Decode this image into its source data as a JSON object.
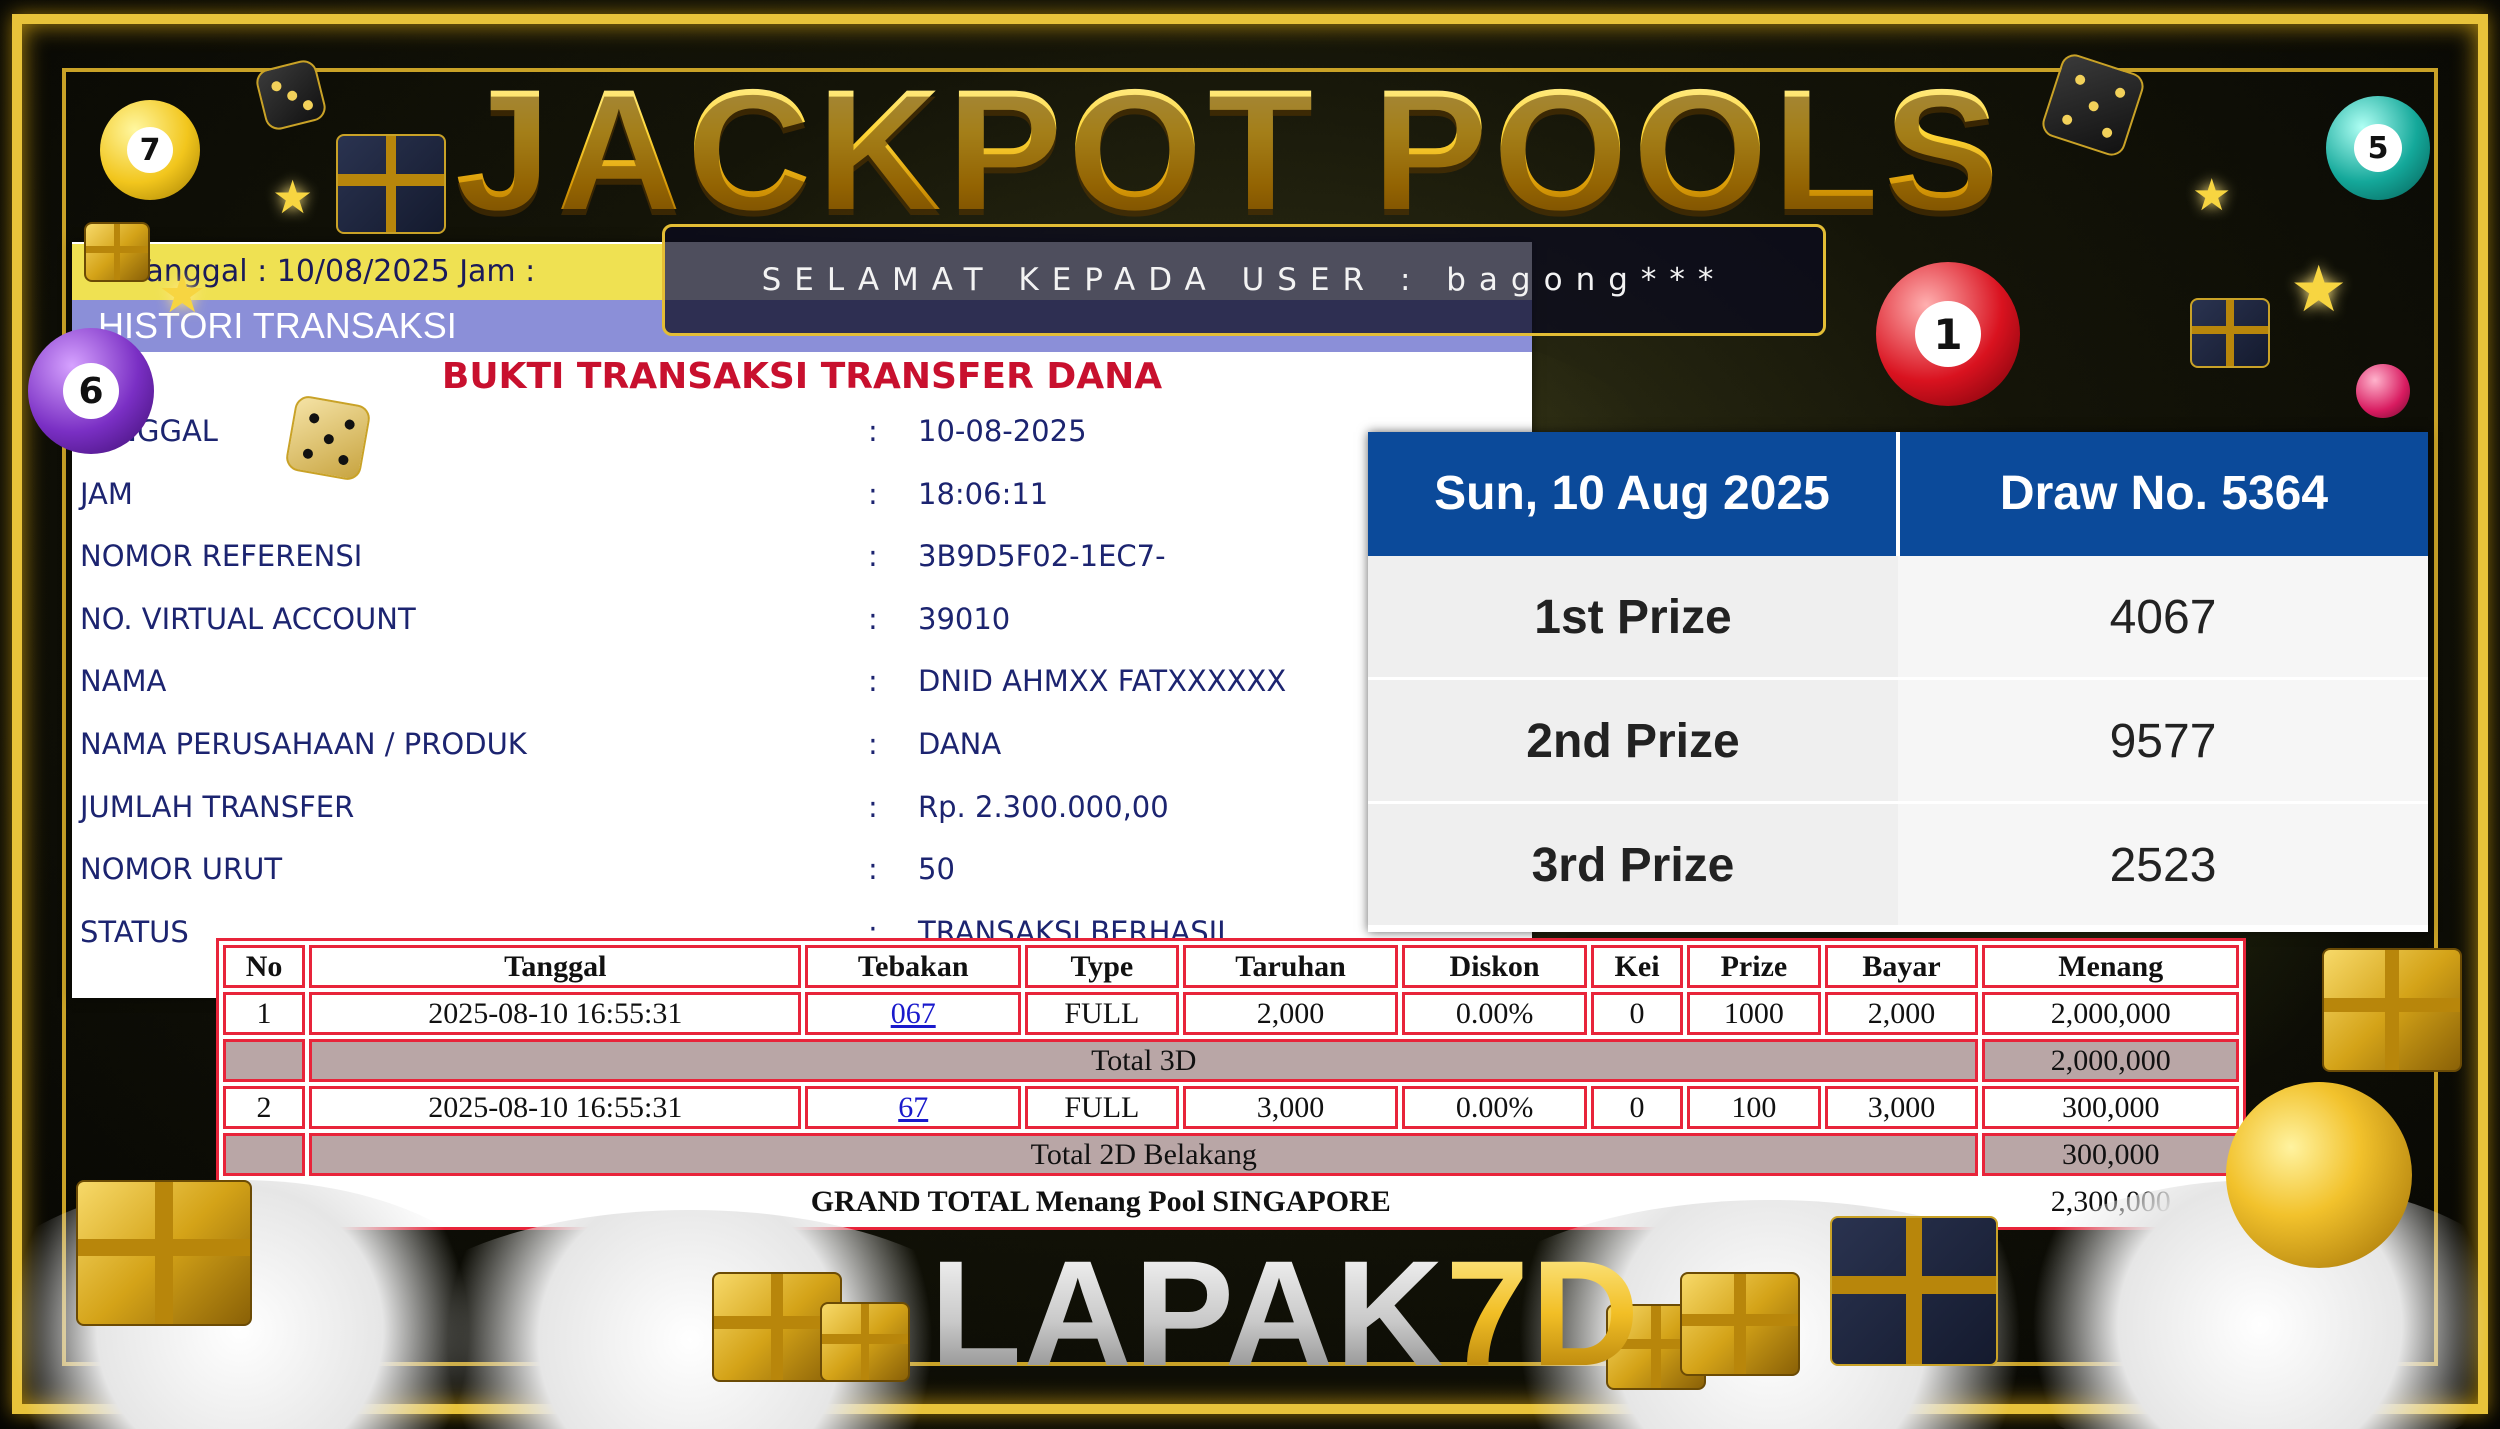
{
  "title": "JACKPOT POOLS",
  "congrats_text": "SELAMAT KEPADA USER : bagong***",
  "receipt": {
    "tanggal_bar": "Tanggal : 10/08/2025 Jam : 18:08:43",
    "histori_label": "HISTORI TRANSAKSI",
    "heading": "BUKTI TRANSAKSI TRANSFER DANA",
    "fields": [
      {
        "label": "TANGGAL",
        "value": "10-08-2025"
      },
      {
        "label": "JAM",
        "value": "18:06:11"
      },
      {
        "label": "NOMOR REFERENSI",
        "value": "3B9D5F02-1EC7-"
      },
      {
        "label": "NO. VIRTUAL ACCOUNT",
        "value": "39010"
      },
      {
        "label": "NAMA",
        "value": "DNID AHMXX FATXXXXXX"
      },
      {
        "label": "NAMA PERUSAHAAN / PRODUK",
        "value": "DANA"
      },
      {
        "label": "JUMLAH TRANSFER",
        "value": "Rp. 2.300.000,00"
      },
      {
        "label": "NOMOR URUT",
        "value": "50"
      },
      {
        "label": "STATUS",
        "value": "TRANSAKSI BERHASIL"
      }
    ],
    "colon": ":"
  },
  "results": {
    "date": "Sun, 10 Aug 2025",
    "draw": "Draw No. 5364",
    "prizes": [
      {
        "label": "1st Prize",
        "number": "4067"
      },
      {
        "label": "2nd Prize",
        "number": "9577"
      },
      {
        "label": "3rd Prize",
        "number": "2523"
      }
    ]
  },
  "bets": {
    "headers": [
      "No",
      "Tanggal",
      "Tebakan",
      "Type",
      "Taruhan",
      "Diskon",
      "Kei",
      "Prize",
      "Bayar",
      "Menang"
    ],
    "rows": [
      {
        "no": "1",
        "tanggal": "2025-08-10 16:55:31",
        "tebakan": "067",
        "type": "FULL",
        "taruhan": "2,000",
        "diskon": "0.00%",
        "kei": "0",
        "prize": "1000",
        "bayar": "2,000",
        "menang": "2,000,000"
      },
      {
        "no": "2",
        "tanggal": "2025-08-10 16:55:31",
        "tebakan": "67",
        "type": "FULL",
        "taruhan": "3,000",
        "diskon": "0.00%",
        "kei": "0",
        "prize": "100",
        "bayar": "3,000",
        "menang": "300,000"
      }
    ],
    "totals": [
      {
        "label": "Total 3D",
        "value": "2,000,000"
      },
      {
        "label": "Total 2D Belakang",
        "value": "300,000"
      }
    ],
    "grand_label": "GRAND TOTAL  Menang Pool SINGAPORE",
    "grand_value": "2,300,000"
  },
  "logo": {
    "part1": "LAPAK",
    "part2": "7D"
  },
  "balls": [
    "7",
    "6",
    "1",
    "5"
  ],
  "colors": {
    "gold": "#e8c33a",
    "blue_header": "#0b4a9a",
    "red_border": "#e8243a",
    "receipt_heading": "#c8102e"
  }
}
